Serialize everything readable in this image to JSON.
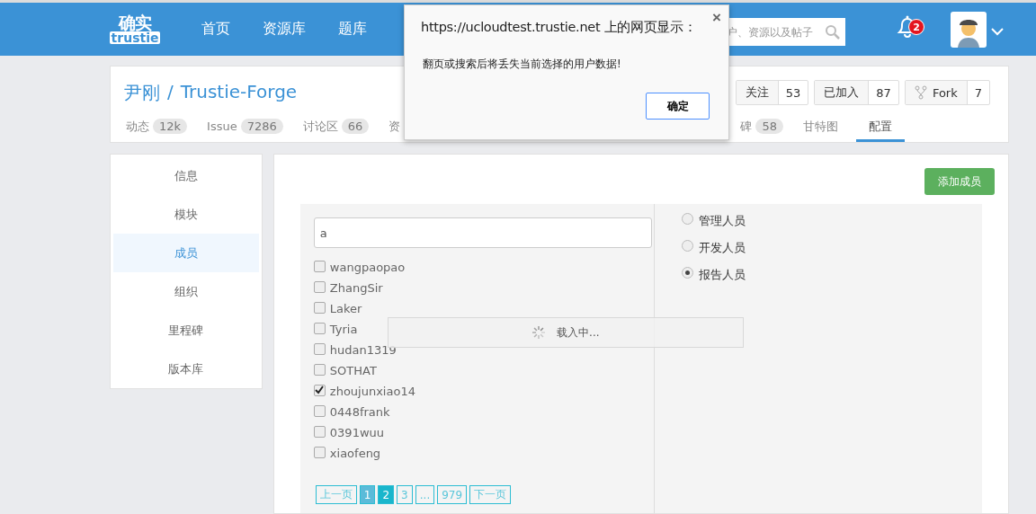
{
  "header": {
    "logo": {
      "mark": "确实",
      "wordmark": "trustie"
    },
    "nav": [
      {
        "label": "首页"
      },
      {
        "label": "资源库"
      },
      {
        "label": "题库"
      }
    ],
    "search": {
      "placeholder": "户、资源以及帖子"
    },
    "notifications": {
      "count": "2"
    }
  },
  "project": {
    "owner": "尹刚",
    "separator": "/",
    "name": "Trustie-Forge",
    "actions": [
      {
        "kind": "plain",
        "label": "关注",
        "count": "53"
      },
      {
        "kind": "plain",
        "label": "已加入",
        "count": "87"
      },
      {
        "kind": "fork",
        "label": "Fork",
        "count": "7"
      }
    ],
    "tabs_left": [
      {
        "label": "动态",
        "count": "12k",
        "selected": false
      },
      {
        "label": "Issue",
        "count": "7286",
        "selected": false
      },
      {
        "label": "讨论区",
        "count": "66",
        "selected": false
      },
      {
        "label": "资",
        "selected": false
      }
    ],
    "tabs_right": [
      {
        "label": "碑",
        "count": "58",
        "selected": false
      },
      {
        "label": "甘特图",
        "selected": false
      },
      {
        "label": "配置",
        "selected": true
      }
    ]
  },
  "sidebar": {
    "items": [
      {
        "label": "信息",
        "selected": false
      },
      {
        "label": "模块",
        "selected": false
      },
      {
        "label": "成员",
        "selected": true
      },
      {
        "label": "组织",
        "selected": false
      },
      {
        "label": "里程碑",
        "selected": false
      },
      {
        "label": "版本库",
        "selected": false
      }
    ]
  },
  "members": {
    "add_button": "添加成员",
    "search_value": "a",
    "users": [
      {
        "name": "wangpaopao",
        "checked": false
      },
      {
        "name": "ZhangSir",
        "checked": false
      },
      {
        "name": "Laker",
        "checked": false
      },
      {
        "name": "Tyria",
        "checked": false
      },
      {
        "name": "hudan1319",
        "checked": false
      },
      {
        "name": "SOTHAT",
        "checked": false
      },
      {
        "name": "zhoujunxiao14",
        "checked": true
      },
      {
        "name": "0448frank",
        "checked": false
      },
      {
        "name": "0391wuu",
        "checked": false
      },
      {
        "name": "xiaofeng",
        "checked": false
      }
    ],
    "roles": [
      {
        "label": "管理人员",
        "selected": false
      },
      {
        "label": "开发人员",
        "selected": false
      },
      {
        "label": "报告人员",
        "selected": true
      }
    ],
    "pagination": [
      {
        "label": "上一页",
        "selected": false,
        "highlighted": false
      },
      {
        "label": "1",
        "selected": false,
        "highlighted": true
      },
      {
        "label": "2",
        "selected": true,
        "highlighted": false
      },
      {
        "label": "3",
        "selected": false,
        "highlighted": false
      },
      {
        "label": "...",
        "selected": false,
        "highlighted": false
      },
      {
        "label": "979",
        "selected": false,
        "highlighted": false
      },
      {
        "label": "下一页",
        "selected": false,
        "highlighted": false
      }
    ],
    "loading": {
      "text": "载入中..."
    }
  },
  "dialog": {
    "title": "https://ucloudtest.trustie.net 上的网页显示：",
    "close": "×",
    "message": "翻页或搜索后将丢失当前选择的用户数据!",
    "button": "确定"
  }
}
